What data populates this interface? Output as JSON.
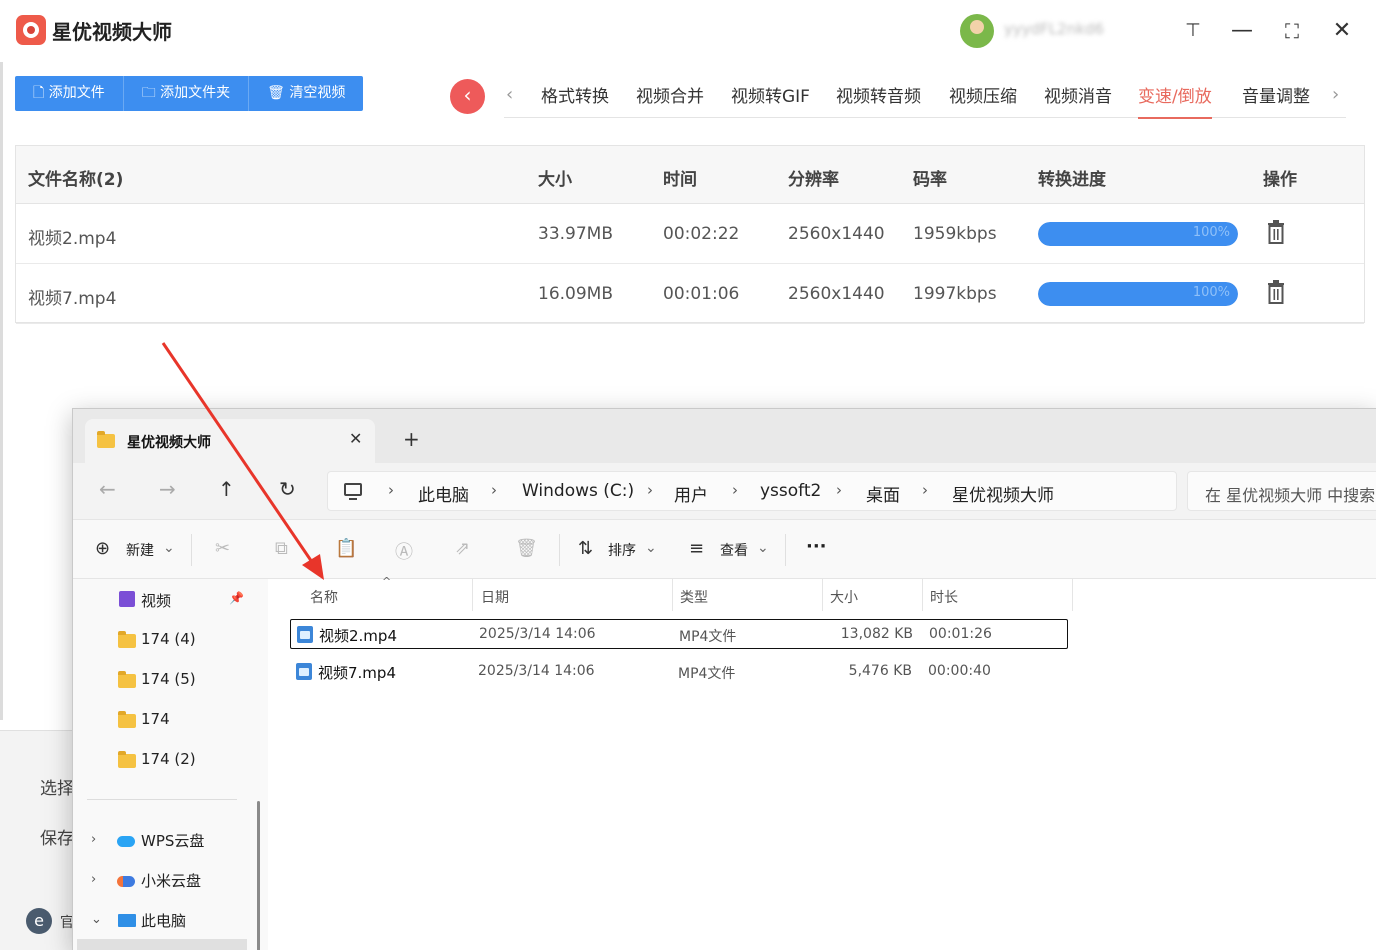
{
  "app": {
    "title": "星优视频大师",
    "username": "yyydFL2nkd6",
    "window_controls": {
      "pin": "⊤",
      "minimize": "—",
      "maximize": "⛶",
      "close": "✕"
    },
    "toolbar": {
      "add_file": "添加文件",
      "add_folder": "添加文件夹",
      "clear_videos": "清空视频"
    },
    "tabs": [
      "格式转换",
      "视频合并",
      "视频转GIF",
      "视频转音频",
      "视频压缩",
      "视频消音",
      "变速/倒放",
      "音量调整"
    ],
    "active_tab": "变速/倒放",
    "table": {
      "headers": {
        "name": "文件名称(2)",
        "size": "大小",
        "time": "时间",
        "resolution": "分辨率",
        "bitrate": "码率",
        "progress": "转换进度",
        "action": "操作"
      },
      "rows": [
        {
          "name": "视频2.mp4",
          "size": "33.97MB",
          "time": "00:02:22",
          "resolution": "2560x1440",
          "bitrate": "1959kbps",
          "progress": 100,
          "progress_label": "100%"
        },
        {
          "name": "视频7.mp4",
          "size": "16.09MB",
          "time": "00:01:06",
          "resolution": "2560x1440",
          "bitrate": "1997kbps",
          "progress": 100,
          "progress_label": "100%"
        }
      ]
    },
    "bottom_labels": {
      "select": "选择",
      "save": "保存",
      "e_label": "官"
    },
    "colors": {
      "accent_blue": "#3d8ef0",
      "accent_red": "#ee5a5a",
      "active_tab": "#e86a5e",
      "annotation_arrow": "#e8352a"
    }
  },
  "explorer": {
    "tab_title": "星优视频大师",
    "breadcrumb": [
      "此电脑",
      "Windows (C:)",
      "用户",
      "yssoft2",
      "桌面",
      "星优视频大师"
    ],
    "search_placeholder": "在 星优视频大师 中搜索",
    "commands": {
      "new": "新建",
      "sort": "排序",
      "view": "查看",
      "more": "···"
    },
    "sidebar": {
      "quick": [
        {
          "label": "视频",
          "icon": "video-folder-icon",
          "pinned": true
        },
        {
          "label": "174 (4)",
          "icon": "folder-icon"
        },
        {
          "label": "174 (5)",
          "icon": "folder-icon"
        },
        {
          "label": "174",
          "icon": "folder-icon"
        },
        {
          "label": "174 (2)",
          "icon": "folder-icon"
        }
      ],
      "drives": [
        {
          "label": "WPS云盘",
          "icon": "wps-cloud-icon"
        },
        {
          "label": "小米云盘",
          "icon": "mi-cloud-icon"
        },
        {
          "label": "此电脑",
          "icon": "this-pc-icon",
          "expanded": true
        }
      ]
    },
    "columns": {
      "name": "名称",
      "date": "日期",
      "type": "类型",
      "size": "大小",
      "duration": "时长"
    },
    "files": [
      {
        "name": "视频2.mp4",
        "date": "2025/3/14 14:06",
        "type": "MP4文件",
        "size": "13,082 KB",
        "duration": "00:01:26",
        "selected": true
      },
      {
        "name": "视频7.mp4",
        "date": "2025/3/14 14:06",
        "type": "MP4文件",
        "size": "5,476 KB",
        "duration": "00:00:40",
        "selected": false
      }
    ]
  }
}
